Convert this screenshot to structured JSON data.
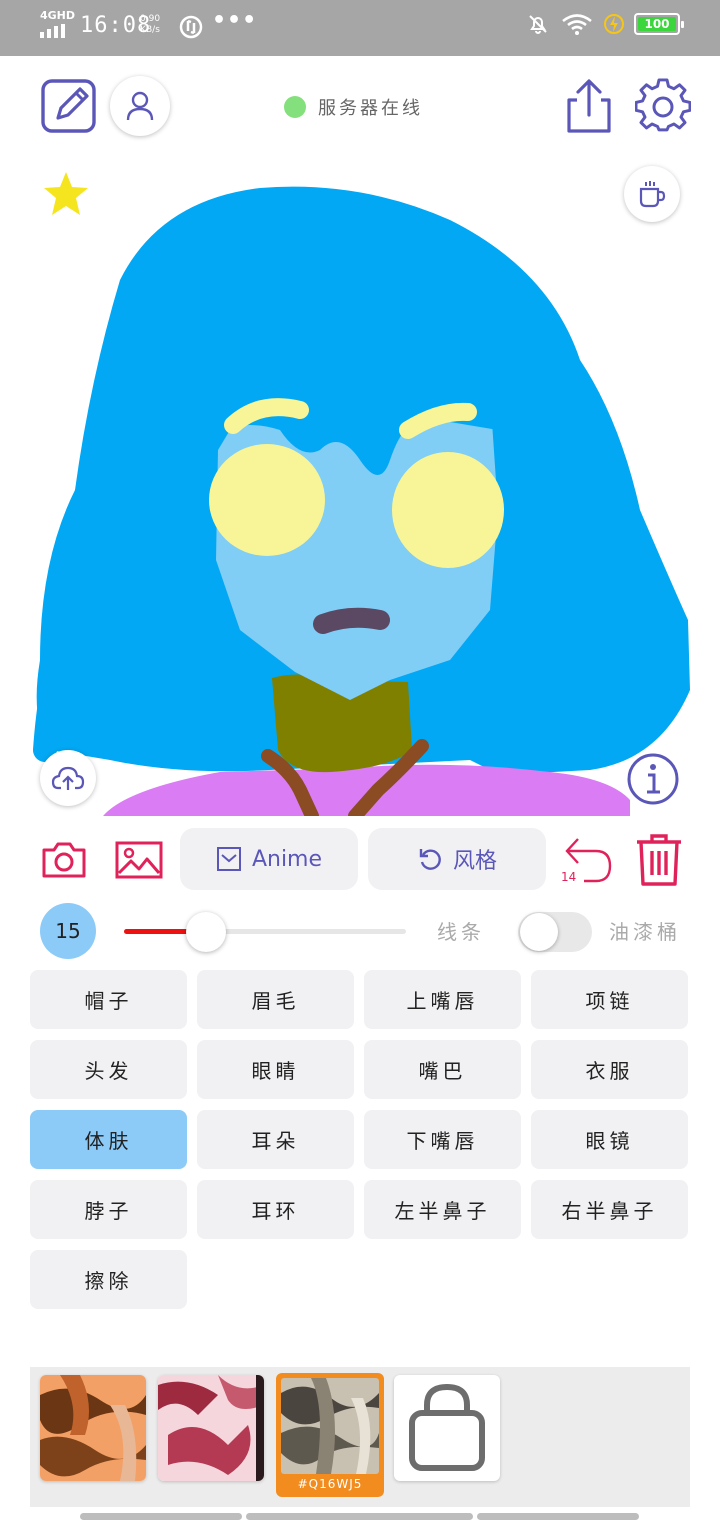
{
  "status_bar": {
    "network": "4GHD",
    "time": "16:08",
    "speed_value": "0.90",
    "speed_unit": "KB/s",
    "more": "•••",
    "battery": "100"
  },
  "header": {
    "server_status": "服务器在线",
    "server_status_color": "#84e07c",
    "accent_color": "#5b57b8"
  },
  "icons": {
    "edit": "edit-icon",
    "profile": "user-icon",
    "share": "share-icon",
    "settings": "gear-icon",
    "favorite": "star-icon",
    "coffee": "coffee-icon",
    "upload": "cloud-upload-icon",
    "info": "info-icon",
    "camera": "camera-icon",
    "gallery": "image-icon",
    "undo": "undo-icon",
    "delete": "trash-icon",
    "lock": "shopping-bag-icon"
  },
  "tools": {
    "anime_label": "Anime",
    "style_label": "风格",
    "undo_count": "14"
  },
  "brush": {
    "size": "15",
    "slider_level": 0.29,
    "line_label": "线条",
    "bucket_label": "油漆桶",
    "bucket_enabled": false,
    "brush_color": "#ee1111"
  },
  "parts": [
    {
      "label": "帽子",
      "selected": false
    },
    {
      "label": "眉毛",
      "selected": false
    },
    {
      "label": "上嘴唇",
      "selected": false
    },
    {
      "label": "项链",
      "selected": false
    },
    {
      "label": "头发",
      "selected": false
    },
    {
      "label": "眼睛",
      "selected": false
    },
    {
      "label": "嘴巴",
      "selected": false
    },
    {
      "label": "衣服",
      "selected": false
    },
    {
      "label": "体肤",
      "selected": true
    },
    {
      "label": "耳朵",
      "selected": false
    },
    {
      "label": "下嘴唇",
      "selected": false
    },
    {
      "label": "眼镜",
      "selected": false
    },
    {
      "label": "脖子",
      "selected": false
    },
    {
      "label": "耳环",
      "selected": false
    },
    {
      "label": "左半鼻子",
      "selected": false
    },
    {
      "label": "右半鼻子",
      "selected": false
    },
    {
      "label": "擦除",
      "selected": false
    }
  ],
  "textures": {
    "selected_code": "#Q16WJ5"
  }
}
